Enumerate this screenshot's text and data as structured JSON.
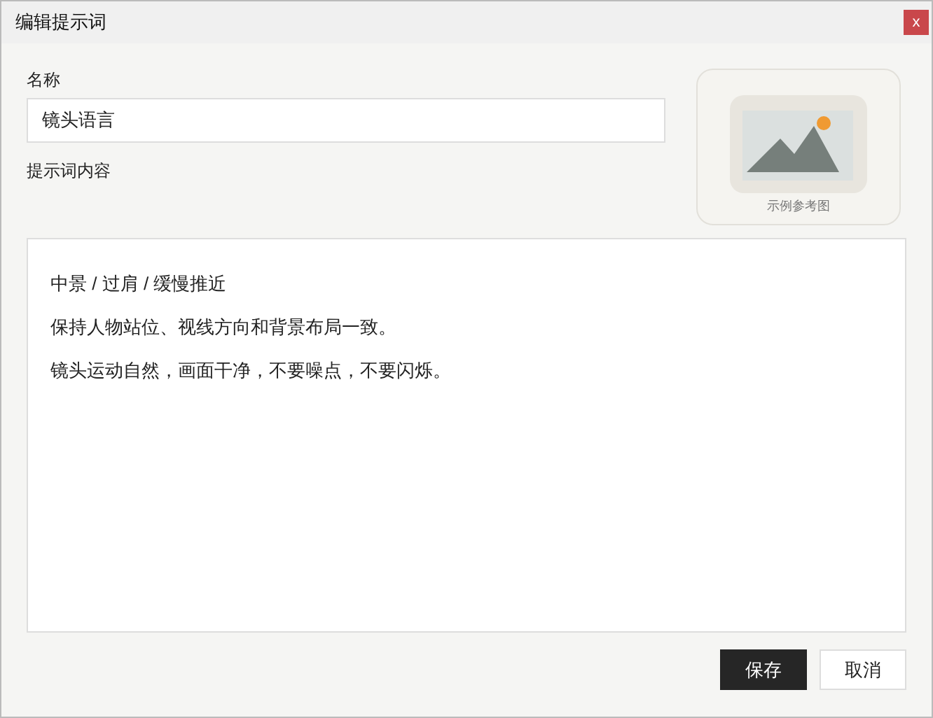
{
  "window": {
    "title": "编辑提示词",
    "close": "x"
  },
  "name_field": {
    "label": "名称",
    "value": "镜头语言"
  },
  "content_field": {
    "label": "提示词内容",
    "lines": [
      "中景 / 过肩 / 缓慢推近",
      "保持人物站位、视线方向和背景布局一致。",
      "镜头运动自然，画面干净，不要噪点，不要闪烁。"
    ]
  },
  "reference_image": {
    "caption": "示例参考图"
  },
  "buttons": [
    {
      "label": "保存",
      "kind": "primary"
    },
    {
      "label": "取消",
      "kind": "secondary"
    }
  ]
}
